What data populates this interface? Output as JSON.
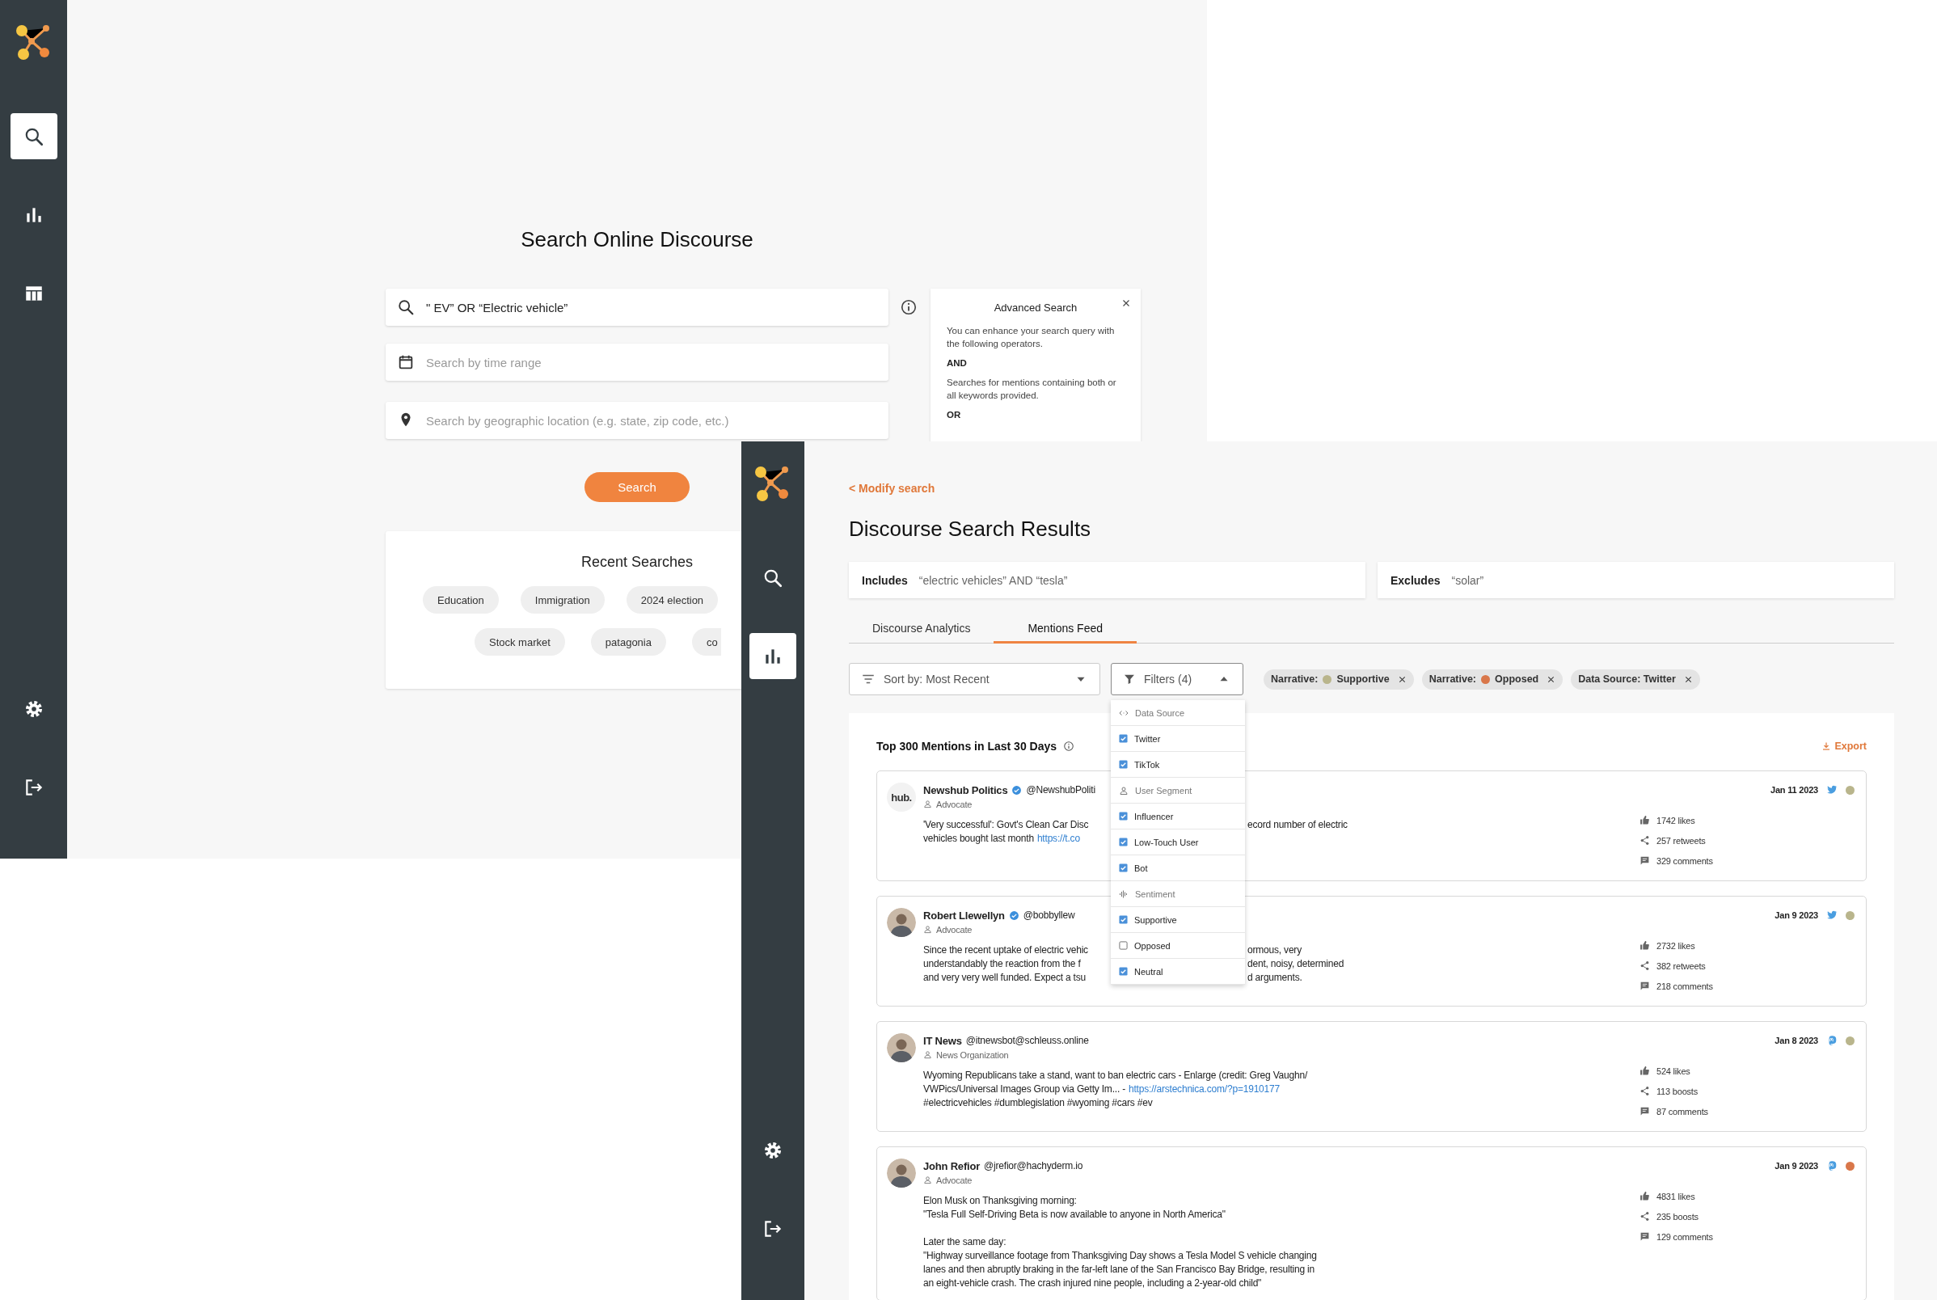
{
  "search_screen": {
    "nav": [
      {
        "kind": "search",
        "selected": true
      },
      {
        "kind": "chart",
        "selected": false
      },
      {
        "kind": "table",
        "selected": false
      }
    ],
    "footer_nav": [
      {
        "kind": "settings",
        "selected": false
      },
      {
        "kind": "logout",
        "selected": false
      }
    ],
    "title": "Search Online Discourse",
    "query_field": {
      "value": "\" EV” OR “Electric vehicle”"
    },
    "time_field": {
      "placeholder": "Search by time range"
    },
    "location_field": {
      "placeholder": "Search by geographic location (e.g. state, zip code, etc.)"
    },
    "search_button": "Search",
    "advanced_search": {
      "title": "Advanced Search",
      "intro": "You can enhance your search query with the following operators.",
      "operators": [
        {
          "name": "AND",
          "description": "Searches for mentions containing both or all keywords provided."
        },
        {
          "name": "OR"
        }
      ]
    },
    "recent_searches": {
      "title": "Recent Searches",
      "rows": [
        [
          "Education",
          "Immigration",
          "2024 election"
        ],
        [
          "Stock market",
          "patagonia",
          "co"
        ]
      ]
    }
  },
  "results_screen": {
    "nav": [
      {
        "kind": "search",
        "selected": false
      },
      {
        "kind": "chart",
        "selected": true
      }
    ],
    "footer_nav": [
      {
        "kind": "settings",
        "selected": false
      },
      {
        "kind": "logout",
        "selected": false
      }
    ],
    "back_link": "< Modify search",
    "title": "Discourse Search Results",
    "includes": {
      "label": "Includes",
      "value": "“electric vehicles” AND “tesla”"
    },
    "excludes": {
      "label": "Excludes",
      "value": "“solar”"
    },
    "tabs": [
      {
        "label": "Discourse Analytics",
        "selected": false
      },
      {
        "label": "Mentions Feed",
        "selected": true
      }
    ],
    "sort": "Sort by: Most Recent",
    "filters": {
      "label": "Filters (4)",
      "expanded": true,
      "items": [
        {
          "kind": "header",
          "label": "Data Source"
        },
        {
          "kind": "option",
          "label": "Twitter",
          "checked": true
        },
        {
          "kind": "option",
          "label": "TikTok",
          "checked": true
        },
        {
          "kind": "header",
          "label": "User Segment"
        },
        {
          "kind": "option",
          "label": "Influencer",
          "checked": true
        },
        {
          "kind": "option",
          "label": "Low-Touch User",
          "checked": true
        },
        {
          "kind": "option",
          "label": "Bot",
          "checked": true
        },
        {
          "kind": "header",
          "label": "Sentiment"
        },
        {
          "kind": "option",
          "label": "Supportive",
          "checked": true
        },
        {
          "kind": "option",
          "label": "Opposed",
          "checked": false
        },
        {
          "kind": "option",
          "label": "Neutral",
          "checked": true
        }
      ]
    },
    "active_filters": [
      {
        "label": "Narrative:",
        "value": "Supportive",
        "color": "#b9b58c"
      },
      {
        "label": "Narrative:",
        "value": "Opposed",
        "color": "#d9774a"
      },
      {
        "label": "Data Source: Twitter"
      }
    ],
    "feed": {
      "title": "Top 300 Mentions in Last 30 Days",
      "export": "Export",
      "posts": [
        {
          "avatar": {
            "kind": "logo",
            "text": "hub."
          },
          "name": "Newshub Politics",
          "verified": true,
          "handle": "@NewshubPoliti",
          "role": "Advocate",
          "date": "Jan 11 2023",
          "kind": "twitter",
          "color": "#b9b58c",
          "stats": [
            "1742 likes",
            "257 retweets",
            "329 comments"
          ],
          "paragraphs": [
            [
              {
                "text": "'Very successful': Govt's Clean Car Disc",
                "right": "ecord number of electric"
              },
              {
                "text": "vehicles bought last month",
                "link": "https://t.co"
              }
            ]
          ]
        },
        {
          "avatar": {
            "kind": "person"
          },
          "name": "Robert Llewellyn",
          "verified": true,
          "handle": "@bobbyllew",
          "role": "Advocate",
          "date": "Jan 9 2023",
          "kind": "twitter",
          "color": "#b9b58c",
          "stats": [
            "2732 likes",
            "382 retweets",
            "218 comments"
          ],
          "paragraphs": [
            [
              {
                "text": "Since the recent uptake of electric vehic",
                "right": "ormous, very"
              },
              {
                "text": "understandably the reaction from the f",
                "right": "dent, noisy, determined"
              },
              {
                "text": "and very very well funded. Expect a tsu",
                "right": "d arguments."
              }
            ]
          ]
        },
        {
          "avatar": {
            "kind": "person"
          },
          "name": "IT News",
          "verified": false,
          "handle": "@itnewsbot@schleuss.online",
          "role": "News Organization",
          "date": "Jan 8 2023",
          "kind": "mastodon",
          "color": "#b9b58c",
          "stats": [
            "524 likes",
            "113 boosts",
            "87 comments"
          ],
          "paragraphs": [
            [
              {
                "text": "Wyoming Republicans take a stand, want to ban electric cars - Enlarge (credit: Greg Vaughn/"
              },
              {
                "text": "VWPics/Universal Images Group via Getty Im... -",
                "link": "https://arstechnica.com/?p=1910177"
              },
              {
                "text": "#electricvehicles #dumblegislation #wyoming #cars #ev"
              }
            ]
          ]
        },
        {
          "avatar": {
            "kind": "person"
          },
          "name": "John Refior",
          "verified": false,
          "handle": "@jrefior@hachyderm.io",
          "role": "Advocate",
          "date": "Jan 9 2023",
          "kind": "mastodon",
          "color": "#d9774a",
          "stats": [
            "4831 likes",
            "235 boosts",
            "129 comments"
          ],
          "paragraphs": [
            [
              {
                "text": "Elon Musk on Thanksgiving morning:"
              },
              {
                "text": "\"Tesla Full Self-Driving Beta is now available to anyone in North America\""
              }
            ],
            [
              {
                "text": "Later the same day:"
              },
              {
                "text": "\"Highway surveillance footage from Thanksgiving Day shows a Tesla Model S vehicle changing"
              },
              {
                "text": "lanes and then abruptly braking in the far-left lane of the San Francisco Bay Bridge, resulting in"
              },
              {
                "text": "an eight-vehicle crash. The crash injured nine people, including a 2-year-old child\""
              }
            ]
          ]
        }
      ]
    }
  }
}
